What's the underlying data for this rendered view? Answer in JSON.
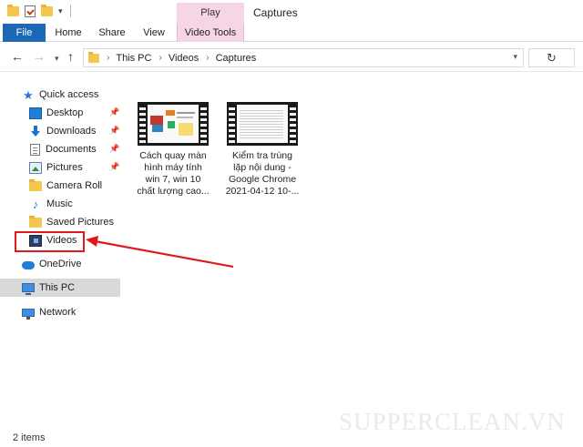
{
  "window": {
    "title": "Captures",
    "contextual_tab_top": "Play"
  },
  "ribbon": {
    "tabs": [
      "File",
      "Home",
      "Share",
      "View",
      "Video Tools"
    ]
  },
  "address": {
    "crumbs": [
      "This PC",
      "Videos",
      "Captures"
    ]
  },
  "nav": {
    "items": [
      {
        "label": "Quick access",
        "icon": "star-icon",
        "pinned": false
      },
      {
        "label": "Desktop",
        "icon": "desktop-icon",
        "pinned": true
      },
      {
        "label": "Downloads",
        "icon": "download-icon",
        "pinned": true
      },
      {
        "label": "Documents",
        "icon": "document-icon",
        "pinned": true
      },
      {
        "label": "Pictures",
        "icon": "pictures-icon",
        "pinned": true
      },
      {
        "label": "Camera Roll",
        "icon": "folder-icon",
        "pinned": false
      },
      {
        "label": "Music",
        "icon": "music-icon",
        "pinned": false
      },
      {
        "label": "Saved Pictures",
        "icon": "folder-icon",
        "pinned": false
      },
      {
        "label": "Videos",
        "icon": "video-icon",
        "pinned": false
      },
      {
        "label": "OneDrive",
        "icon": "cloud-icon",
        "pinned": false
      },
      {
        "label": "This PC",
        "icon": "computer-icon",
        "pinned": false
      },
      {
        "label": "Network",
        "icon": "network-icon",
        "pinned": false
      }
    ]
  },
  "files": [
    {
      "name_lines": [
        "Cách quay màn",
        "hình máy tính",
        "win 7, win 10",
        "chất lượng cao..."
      ]
    },
    {
      "name_lines": [
        "Kiểm tra trùng",
        "lặp nội dung -",
        "Google Chrome",
        "2021-04-12 10-..."
      ]
    }
  ],
  "status": {
    "item_count": "2 items"
  },
  "watermark": "SUPPERCLEAN.VN",
  "colors": {
    "file_tab": "#1c67b6",
    "video_tools": "#f6d5e7",
    "highlight": "#e0181e"
  }
}
